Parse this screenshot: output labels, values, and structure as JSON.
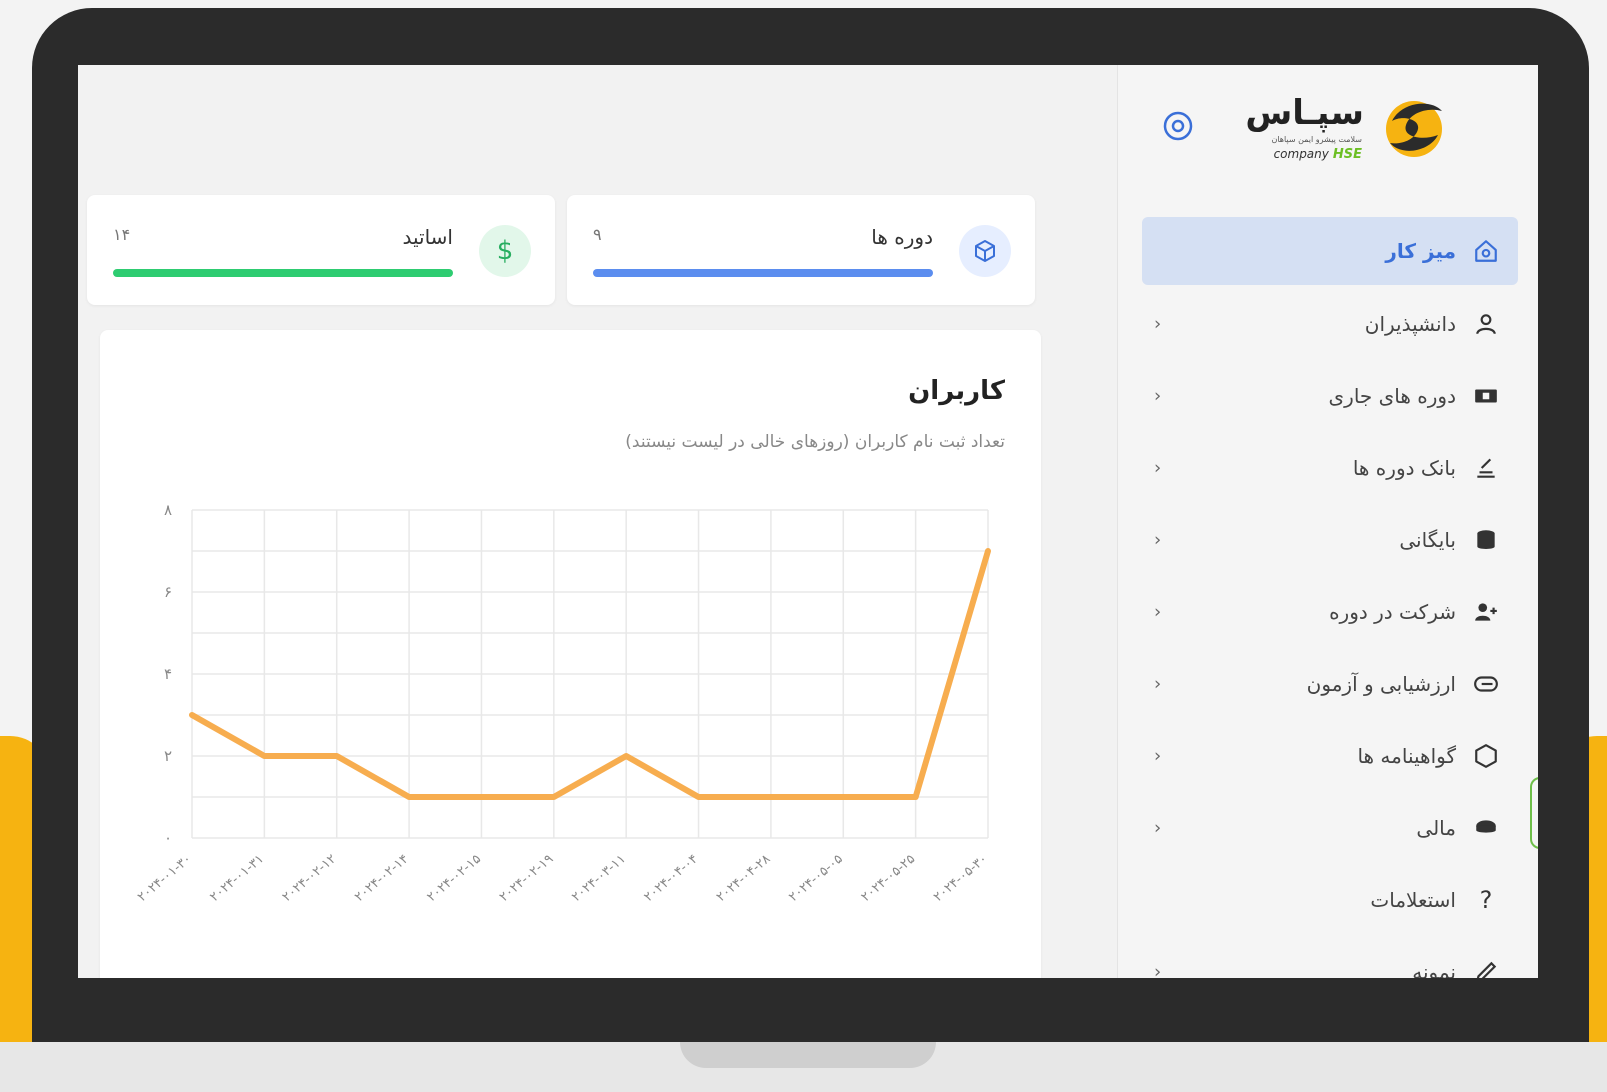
{
  "brand": {
    "name": "سپـاس",
    "tagline": "سلامت پیشرو ایمن سپاهان",
    "hse": "HSE",
    "company": "company"
  },
  "sidebar": {
    "items": [
      {
        "label": "میز کار",
        "icon": "home-icon",
        "active": true,
        "chevron": false
      },
      {
        "label": "دانشپذیران",
        "icon": "user-icon",
        "active": false,
        "chevron": true
      },
      {
        "label": "دوره های جاری",
        "icon": "ticket-icon",
        "active": false,
        "chevron": true
      },
      {
        "label": "بانک دوره ها",
        "icon": "stack-icon",
        "active": false,
        "chevron": true
      },
      {
        "label": "بایگانی",
        "icon": "database-icon",
        "active": false,
        "chevron": true
      },
      {
        "label": "شرکت در دوره",
        "icon": "user-plus-icon",
        "active": false,
        "chevron": true
      },
      {
        "label": "ارزشیابی و آزمون",
        "icon": "paperclip-icon",
        "active": false,
        "chevron": true
      },
      {
        "label": "گواهینامه ها",
        "icon": "hexagon-icon",
        "active": false,
        "chevron": true
      },
      {
        "label": "مالی",
        "icon": "coin-icon",
        "active": false,
        "chevron": true
      },
      {
        "label": "استعلامات",
        "icon": "question-icon",
        "active": false,
        "chevron": false
      },
      {
        "label": "نمونه",
        "icon": "pen-icon",
        "active": false,
        "chevron": true
      }
    ],
    "chevron_glyph": "‹"
  },
  "stats": [
    {
      "label": "دوره ها",
      "value": "۹",
      "icon": "cube-icon",
      "color": "#5b8def",
      "icon_bg": "#e6eeff"
    },
    {
      "label": "اساتید",
      "value": "۱۴",
      "icon": "dollar-icon",
      "color": "#2ecc71",
      "icon_bg": "#e2f7ea"
    }
  ],
  "chart": {
    "title": "کاربران",
    "subtitle": "تعداد ثبت نام کاربران (روزهای خالی در لیست نیستند)"
  },
  "chart_data": {
    "type": "line",
    "x": [
      "۲۰۲۴-۰۱-۳۰",
      "۲۰۲۴-۰۱-۳۱",
      "۲۰۲۴-۰۲-۱۲",
      "۲۰۲۴-۰۲-۱۴",
      "۲۰۲۴-۰۲-۱۵",
      "۲۰۲۴-۰۲-۱۹",
      "۲۰۲۴-۰۳-۱۱",
      "۲۰۲۴-۰۴-۰۴",
      "۲۰۲۴-۰۴-۲۸",
      "۲۰۲۴-۰۵-۰۵",
      "۲۰۲۴-۰۵-۲۵",
      "۲۰۲۴-۰۵-۳۰"
    ],
    "values": [
      3,
      2,
      2,
      1,
      1,
      1,
      2,
      1,
      1,
      1,
      1,
      7
    ],
    "ylim": [
      0,
      8
    ],
    "yticks": [
      0,
      2,
      4,
      6,
      8
    ],
    "ytick_labels": [
      "۰",
      "۲",
      "۴",
      "۶",
      "۸"
    ],
    "color": "#f7ad4f",
    "grid": true
  }
}
